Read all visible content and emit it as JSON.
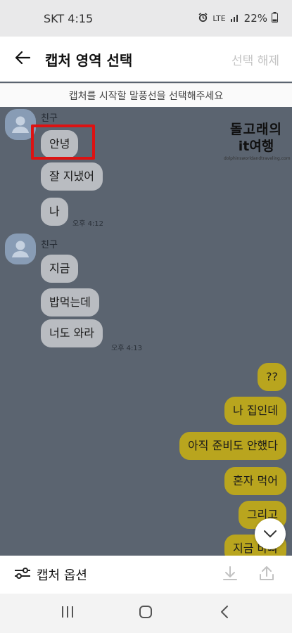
{
  "status_bar": {
    "time": "SKT 4:15",
    "network": "LTE",
    "battery": "22%"
  },
  "header": {
    "title": "캡처 영역 선택",
    "deselect": "선택 해제"
  },
  "hint": "캡처를 시작할 말풍선을 선택해주세요",
  "watermark": {
    "line1": "돌고래의",
    "line2": "it여행",
    "url": "dolphinsworldandtraveling.com"
  },
  "chat": {
    "groups": [
      {
        "sender": "친구",
        "messages": [
          "안녕",
          "잘 지냈어",
          "나"
        ],
        "time": "오후 4:12"
      },
      {
        "sender": "친구",
        "messages": [
          "지금",
          "밥먹는데",
          "너도 와라"
        ],
        "time": "오후 4:13"
      }
    ],
    "outgoing": [
      "??",
      "나 집인데",
      "아직 준비도 안했다",
      "혼자 먹어",
      "그리고",
      "지금 바빠"
    ]
  },
  "bottom_bar": {
    "capture_option": "캡처 옵션"
  },
  "icons": {
    "back": "arrow-left-icon",
    "avatar": "person-icon",
    "scroll": "chevron-down-icon",
    "options": "sliders-icon",
    "download": "download-icon",
    "share": "share-icon"
  },
  "colors": {
    "chat_bg": "#5b6470",
    "incoming_bubble": "#b9bcc1",
    "outgoing_bubble": "#b9a51e",
    "selection": "#dd1212"
  }
}
